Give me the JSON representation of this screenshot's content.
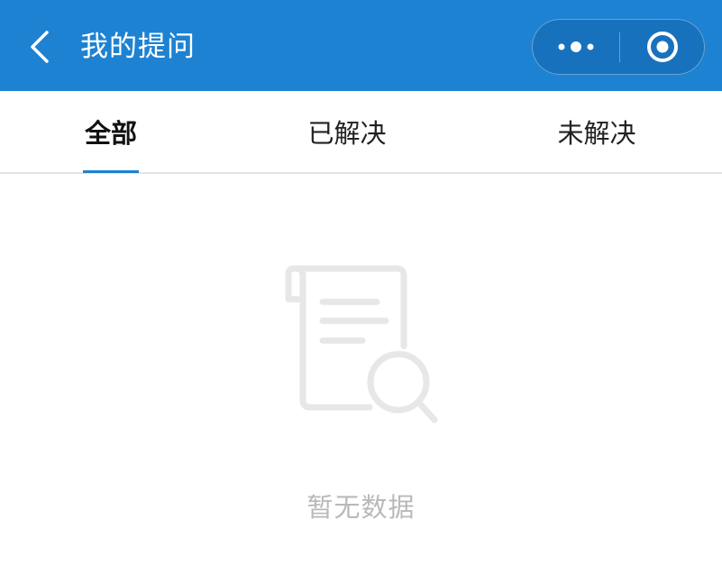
{
  "header": {
    "title": "我的提问",
    "background_color": "#1e82d2",
    "back_icon": "chevron-left-icon",
    "more_icon": "more-dots-icon",
    "close_icon": "target-circle-icon"
  },
  "tabs": [
    {
      "label": "全部",
      "active": true
    },
    {
      "label": "已解决",
      "active": false
    },
    {
      "label": "未解决",
      "active": false
    }
  ],
  "empty_state": {
    "icon": "document-search-icon",
    "message": "暂无数据",
    "text_color": "#b9b9b9"
  },
  "accent_color": "#1e82d2"
}
